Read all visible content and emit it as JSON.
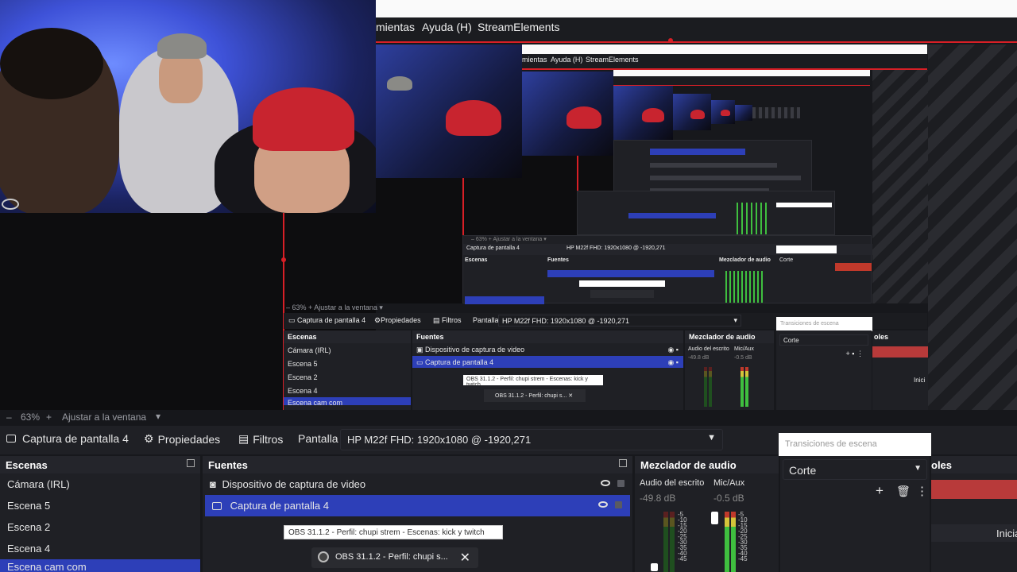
{
  "menu": {
    "items": [
      "mientas",
      "Ayuda (H)",
      "StreamElements"
    ]
  },
  "mini_level1": {
    "menu": [
      "mientas",
      "Ayuda (H)",
      "StreamElements"
    ],
    "zoom": "63%",
    "fit": "Ajustar a la ventana",
    "source_name": "Captura de pantalla 4",
    "props": "Propiedades",
    "filters": "Filtros",
    "screen_label": "Pantalla",
    "screen_value": "HP M22f FHD: 1920x1080 @ -1920,271",
    "transitions": "Transiciones de escena",
    "scenes_head": "Escenas",
    "scenes": [
      "Cámara (IRL)",
      "Escena 5",
      "Escena 2",
      "Escena 4",
      "Escena cam com"
    ],
    "sources_head": "Fuentes",
    "sources": [
      "Dispositivo de captura de video",
      "Captura de pantalla 4"
    ],
    "mixer_head": "Mezclador de audio",
    "mixer_ch1": "Audio del escrito",
    "mixer_ch2": "Mic/Aux",
    "db1": "-49.8 dB",
    "db2": "-0.5 dB",
    "cut": "Corte",
    "controls_head": "oles",
    "start": "Inici",
    "tooltip": "OBS 31.1.2 - Perfil: chupi strem - Escenas: kick y twitch",
    "task": "OBS 31.1.2 - Perfil: chupi s..."
  },
  "zoombar": {
    "zoom": "63%",
    "fit": "Ajustar a la ventana"
  },
  "toolbar": {
    "source_name": "Captura de pantalla 4",
    "props": "Propiedades",
    "filters": "Filtros",
    "screen_label": "Pantalla",
    "screen_value": "HP M22f FHD: 1920x1080 @ -1920,271"
  },
  "transitions": {
    "placeholder": "Transiciones de escena",
    "selected": "Corte"
  },
  "scenes": {
    "title": "Escenas",
    "items": [
      "Cámara (IRL)",
      "Escena 5",
      "Escena 2",
      "Escena 4",
      "Escena cam com"
    ]
  },
  "sources": {
    "title": "Fuentes",
    "items": [
      "Dispositivo de captura de video",
      "Captura de pantalla 4"
    ]
  },
  "mixer": {
    "title": "Mezclador de audio",
    "ch1_name": "Audio del escrito",
    "ch2_name": "Mic/Aux",
    "ch1_db": "-49.8 dB",
    "ch2_db": "-0.5 dB",
    "scale": [
      "-5",
      "-10",
      "-15",
      "-20",
      "-25",
      "-30",
      "-35",
      "-40",
      "-45"
    ]
  },
  "controls": {
    "title_partial": "oles",
    "start_partial": "Inicia"
  },
  "tooltip": {
    "text": "OBS 31.1.2 - Perfil: chupi strem - Escenas: kick y twitch"
  },
  "taskbar": {
    "label": "OBS 31.1.2 - Perfil: chupi s..."
  },
  "colors": {
    "accent_selected": "#2d3fb8",
    "brand_red": "#d71f26",
    "panel_bg": "#1f2025"
  }
}
